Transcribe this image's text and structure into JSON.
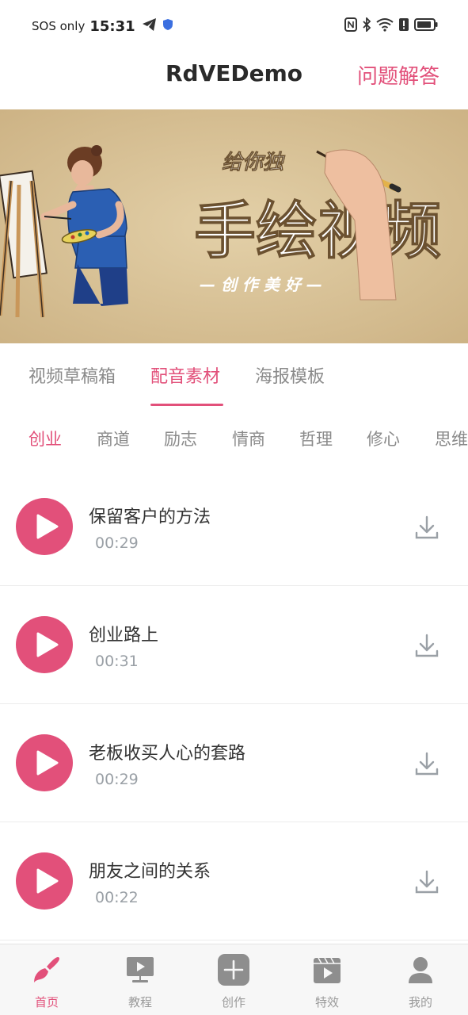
{
  "status_bar": {
    "sos": "SOS only",
    "time": "15:31",
    "icons": [
      "telegram-icon",
      "shield-icon",
      "nfc-icon",
      "bluetooth-icon",
      "wifi-icon",
      "alert-icon",
      "battery-icon"
    ]
  },
  "header": {
    "title": "RdVEDemo",
    "faq": "问题解答"
  },
  "banner": {
    "line1": "给你独",
    "headline": "手绘视频",
    "tagline": "— 创 作 美 好 —"
  },
  "main_tabs": [
    {
      "label": "视频草稿箱",
      "active": false
    },
    {
      "label": "配音素材",
      "active": true
    },
    {
      "label": "海报模板",
      "active": false
    }
  ],
  "categories": [
    {
      "label": "创业",
      "active": true
    },
    {
      "label": "商道",
      "active": false
    },
    {
      "label": "励志",
      "active": false
    },
    {
      "label": "情商",
      "active": false
    },
    {
      "label": "哲理",
      "active": false
    },
    {
      "label": "修心",
      "active": false
    },
    {
      "label": "思维",
      "active": false
    }
  ],
  "audio_list": [
    {
      "title": "保留客户的方法",
      "duration": "00:29"
    },
    {
      "title": "创业路上",
      "duration": "00:31"
    },
    {
      "title": "老板收买人心的套路",
      "duration": "00:29"
    },
    {
      "title": "朋友之间的关系",
      "duration": "00:22"
    }
  ],
  "bottom_nav": [
    {
      "label": "首页",
      "icon": "brush-icon",
      "active": true
    },
    {
      "label": "教程",
      "icon": "tutorial-icon",
      "active": false
    },
    {
      "label": "创作",
      "icon": "plus-icon",
      "active": false
    },
    {
      "label": "特效",
      "icon": "effects-icon",
      "active": false
    },
    {
      "label": "我的",
      "icon": "profile-icon",
      "active": false
    }
  ],
  "colors": {
    "accent": "#e2507a",
    "muted": "#9aa0a6",
    "banner_bg": "#d9c49b"
  }
}
